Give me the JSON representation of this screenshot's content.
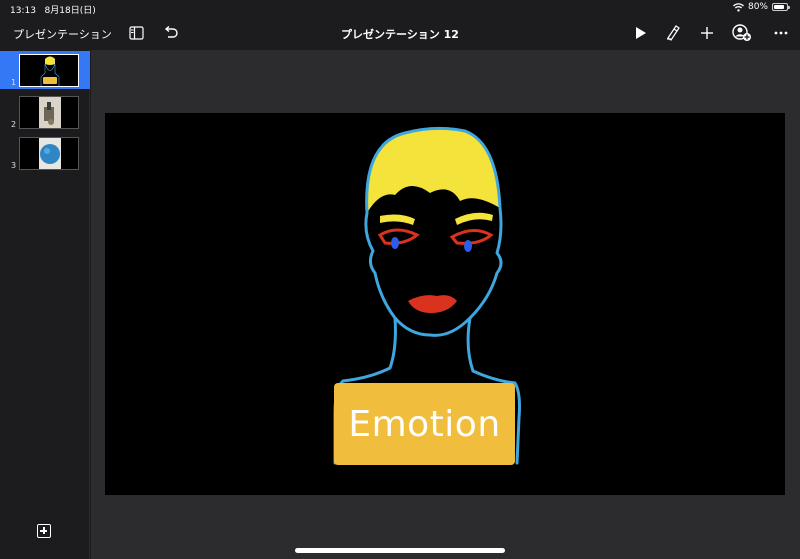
{
  "status_bar": {
    "time": "13:13",
    "date": "8月18日(日)",
    "battery_percent": 80,
    "battery_label": "80%"
  },
  "toolbar": {
    "back_label": "プレゼンテーション",
    "document_title": "プレゼンテーション 12",
    "icons": [
      "sidebar-toggle-icon",
      "undo-icon",
      "play-icon",
      "format-brush-icon",
      "add-icon",
      "collaborate-icon",
      "more-icon"
    ]
  },
  "slide_navigator": {
    "slides": [
      {
        "number": "1",
        "selected": true
      },
      {
        "number": "2",
        "selected": false
      },
      {
        "number": "3",
        "selected": false
      }
    ]
  },
  "slide": {
    "label": "Emotion",
    "colors": {
      "background": "#000000",
      "label_box": "#f0bd3c",
      "outline": "#3ea7e0",
      "hair": "#f3e33a",
      "lips": "#d9321f",
      "eyes": "#2b5ee8"
    }
  },
  "colors": {
    "accent": "#3478f6",
    "toolbar_bg": "#1c1c1e",
    "canvas_bg": "#2c2c2e"
  }
}
